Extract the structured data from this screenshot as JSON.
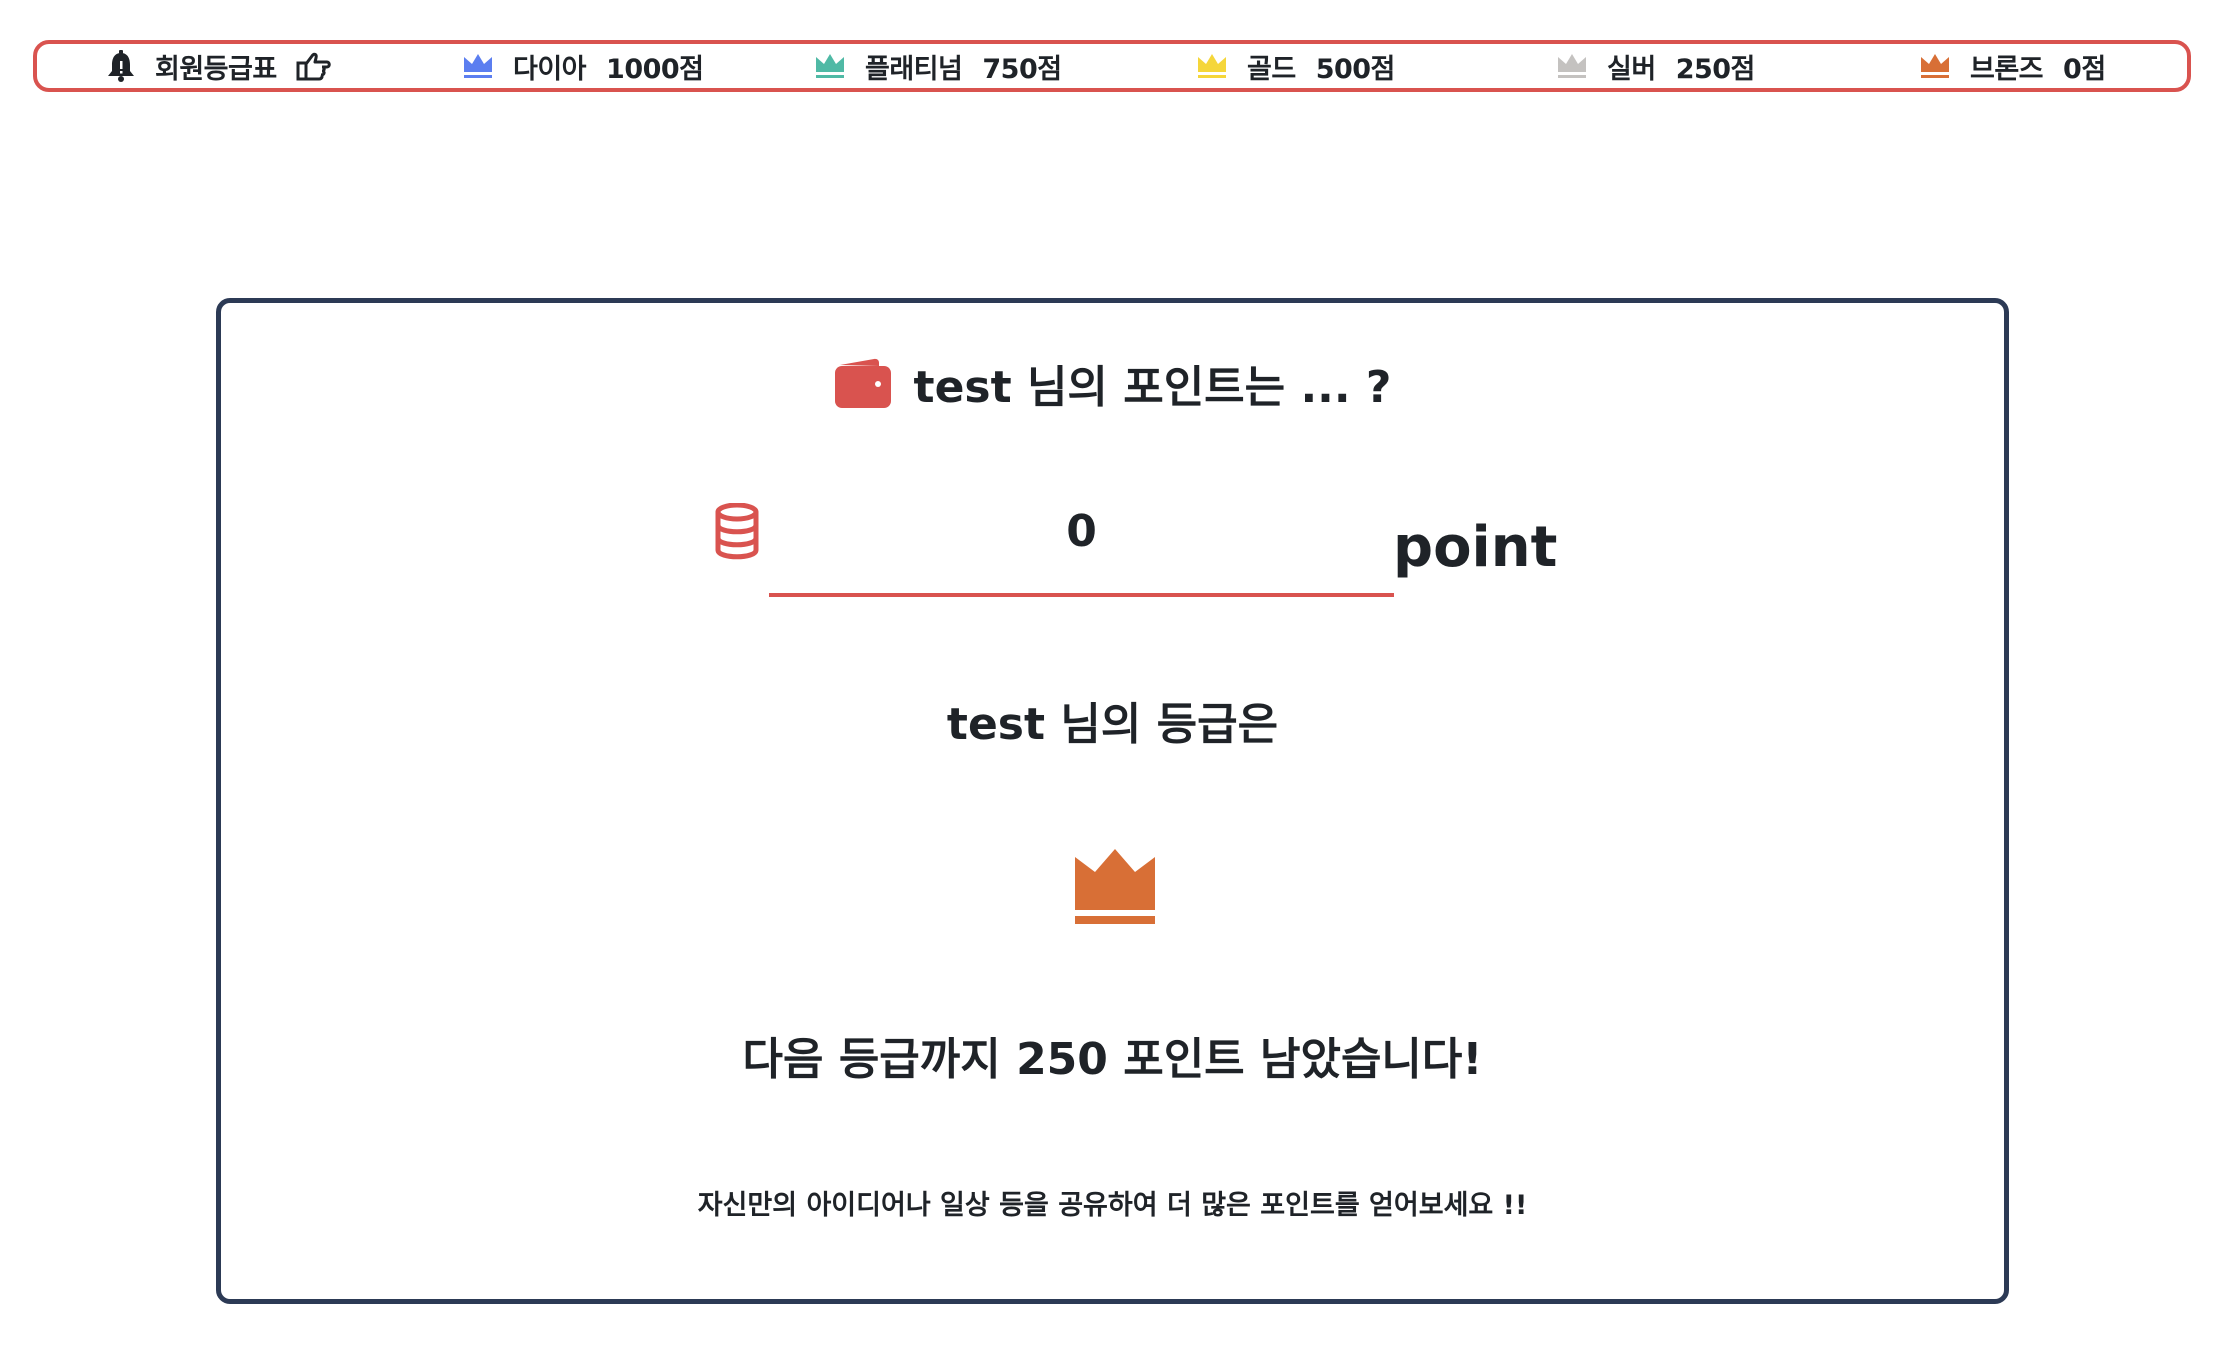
{
  "grade_table": {
    "title": "회원등급표",
    "grades": [
      {
        "name": "다이아",
        "points": "1000점",
        "color": "#5b7ef0"
      },
      {
        "name": "플래티넘",
        "points": "750점",
        "color": "#4fb9a5"
      },
      {
        "name": "골드",
        "points": "500점",
        "color": "#f5d63a"
      },
      {
        "name": "실버",
        "points": "250점",
        "color": "#c4c2c0"
      },
      {
        "name": "브론즈",
        "points": "0점",
        "color": "#d86f36"
      }
    ]
  },
  "colors": {
    "accent": "#d9534f",
    "card_border": "#2c3a55",
    "current_grade": "#d86f36"
  },
  "icons": {
    "bell": "bell-icon",
    "hand": "pointing-hand-icon",
    "wallet": "wallet-icon",
    "coins": "coins-icon",
    "crown": "crown-icon"
  },
  "card": {
    "title": "test 님의 포인트는 ... ?",
    "point_value": "0",
    "point_unit": "point",
    "grade_label": "test 님의 등급은",
    "next_grade_message": "다음 등급까지 250 포인트 남았습니다!",
    "hint": "자신만의 아이디어나 일상 등을 공유하여 더 많은 포인트를 얻어보세요 !!"
  }
}
